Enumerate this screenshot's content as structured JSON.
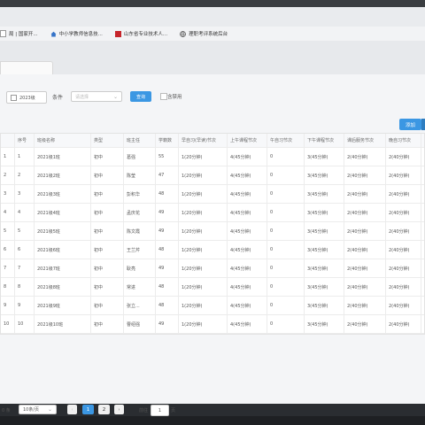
{
  "bookmarks": [
    {
      "label": "局 | 国家开...",
      "icon": "page-icon"
    },
    {
      "label": "中小学教师信息技...",
      "icon": "home-icon"
    },
    {
      "label": "山东省专业技术人...",
      "icon": "red-box-icon"
    },
    {
      "label": "理职考评系统后台",
      "icon": "globe-icon"
    }
  ],
  "filter": {
    "year": "2023级",
    "condition_label": "条件",
    "condition_placeholder": "请选择",
    "query_label": "查询",
    "disabled_label": "含禁用"
  },
  "add_label": "添加",
  "table": {
    "headers": [
      "",
      "序号",
      "班级名称",
      "类型",
      "班主任",
      "学籍数",
      "早自习(早读)节次",
      "上午课程节次",
      "午自习节次",
      "下午课程节次",
      "课后服务节次",
      "晚自习节次",
      ""
    ],
    "rows": [
      [
        "1",
        "1",
        "2021级1班",
        "初中",
        "葛强",
        "55",
        "1(20分钟)",
        "4(45分钟)",
        "0",
        "3(45分钟)",
        "2(40分钟)",
        "2(40分钟)"
      ],
      [
        "2",
        "2",
        "2021级2班",
        "初中",
        "陈莹",
        "47",
        "1(20分钟)",
        "4(45分钟)",
        "0",
        "3(45分钟)",
        "2(40分钟)",
        "2(40分钟)"
      ],
      [
        "3",
        "3",
        "2021级3班",
        "初中",
        "彭积华",
        "48",
        "1(20分钟)",
        "4(45分钟)",
        "0",
        "3(45分钟)",
        "2(40分钟)",
        "2(40分钟)"
      ],
      [
        "4",
        "4",
        "2021级4班",
        "初中",
        "孟庆花",
        "49",
        "1(20分钟)",
        "4(45分钟)",
        "0",
        "3(45分钟)",
        "2(40分钟)",
        "2(40分钟)"
      ],
      [
        "5",
        "5",
        "2021级5班",
        "初中",
        "陈文霞",
        "49",
        "1(20分钟)",
        "4(45分钟)",
        "0",
        "3(45分钟)",
        "2(40分钟)",
        "2(40分钟)"
      ],
      [
        "6",
        "6",
        "2021级6班",
        "初中",
        "王兰芹",
        "48",
        "1(20分钟)",
        "4(45分钟)",
        "0",
        "3(45分钟)",
        "2(40分钟)",
        "2(40分钟)"
      ],
      [
        "7",
        "7",
        "2021级7班",
        "初中",
        "耿亮",
        "49",
        "1(20分钟)",
        "4(45分钟)",
        "0",
        "3(45分钟)",
        "2(40分钟)",
        "2(40分钟)"
      ],
      [
        "8",
        "8",
        "2021级8班",
        "初中",
        "常进",
        "48",
        "1(20分钟)",
        "4(45分钟)",
        "0",
        "3(45分钟)",
        "2(40分钟)",
        "2(40分钟)"
      ],
      [
        "9",
        "9",
        "2021级9班",
        "初中",
        "张立...",
        "48",
        "1(20分钟)",
        "4(45分钟)",
        "0",
        "3(45分钟)",
        "2(40分钟)",
        "2(40分钟)"
      ],
      [
        "10",
        "10",
        "2021级10班",
        "初中",
        "曹绍强",
        "49",
        "1(20分钟)",
        "4(45分钟)",
        "0",
        "3(45分钟)",
        "2(40分钟)",
        "2(40分钟)"
      ]
    ]
  },
  "pager": {
    "total": "0 条",
    "page_size": "10条/页",
    "pages": [
      "1",
      "2"
    ],
    "goto_label": "前往",
    "goto_value": "1",
    "page_suffix": "页"
  },
  "colors": {
    "accent": "#3b97e3"
  }
}
